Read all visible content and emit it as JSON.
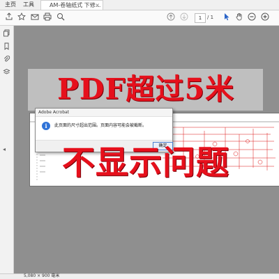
{
  "tabs": {
    "home": "主页",
    "tools": "工具",
    "document": "AM-卷轴纸式 下修...",
    "close_symbol": "×"
  },
  "toolbar": {
    "page_current": "1",
    "page_total": "/ 1",
    "icons": [
      "upload-icon",
      "star-icon",
      "email-icon",
      "print-icon",
      "zoom-search-icon",
      "page-up-icon",
      "page-down-icon",
      "cursor-icon",
      "hand-icon",
      "zoom-out-icon",
      "zoom-in-icon"
    ]
  },
  "left_rail": {
    "icons": [
      "copy-pages-icon",
      "bookmark-icon",
      "attachment-icon",
      "layers-icon"
    ],
    "toggle": "◂"
  },
  "overlay_text": {
    "line1": "PDF超过5米",
    "line2": "不显示问题"
  },
  "dialog": {
    "title": "Adobe Acrobat",
    "message": "此页面的尺寸超出范围。页面内容可能会被截断。",
    "ok_button": "确定",
    "icon_glyph": "i"
  },
  "status_bar": {
    "page_size": "5,080 × 900 毫米"
  }
}
